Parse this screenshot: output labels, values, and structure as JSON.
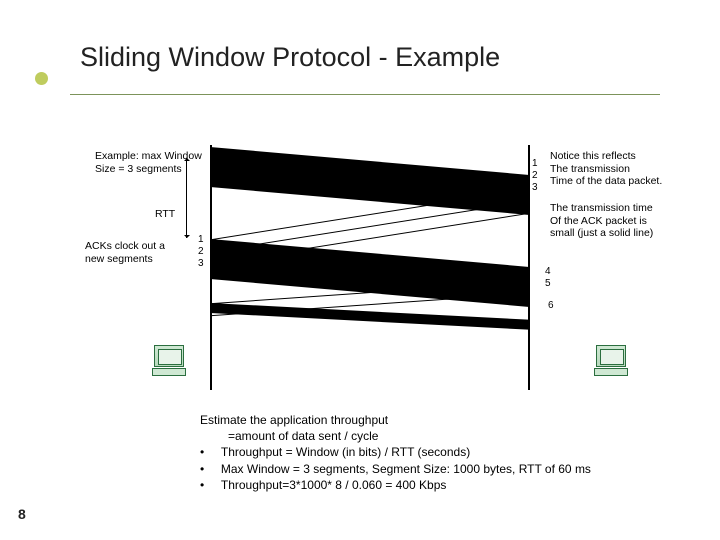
{
  "title": "Sliding Window Protocol - Example",
  "slide_number": "8",
  "labels": {
    "example_box": "Example: max Window\nSize = 3 segments",
    "rtt": "RTT",
    "ack_clock": "ACKs clock out a\nnew segments",
    "notice_top": "Notice this reflects\nThe transmission\nTime of the data packet.",
    "notice_bottom": "The transmission time\nOf the ACK packet is\nsmall (just a solid line)"
  },
  "seq": {
    "right_top": [
      "1",
      "2",
      "3"
    ],
    "left_mid": [
      "1",
      "2",
      "3"
    ],
    "right_mid": [
      "4",
      "5"
    ],
    "right_low": "6"
  },
  "estimate": {
    "line1": "Estimate the application throughput",
    "line2": "=amount of data sent / cycle",
    "bullet1": "Throughput = Window (in bits) / RTT (seconds)",
    "bullet2": "Max Window = 3 segments,  Segment Size: 1000 bytes, RTT of 60 ms",
    "bullet3": "Throughput=3*1000* 8 / 0.060 = 400 Kbps"
  }
}
